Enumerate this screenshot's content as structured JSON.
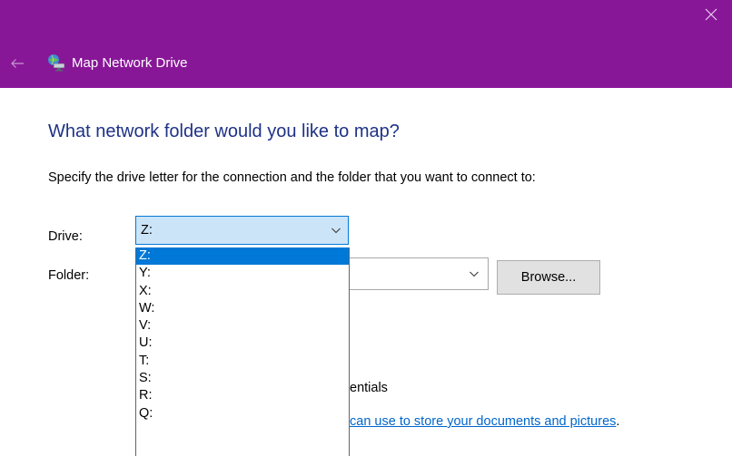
{
  "window": {
    "title": "Map Network Drive",
    "close_glyph": "×",
    "back_glyph": "←",
    "colors": {
      "titlebar": "#881798",
      "accent": "#0078d7",
      "heading": "#1e3287",
      "link": "#0066cc"
    },
    "icons": {
      "back": "back-arrow-icon",
      "app": "network-drive-icon",
      "close": "close-icon",
      "dropdown": "chevron-down-icon"
    }
  },
  "content": {
    "heading": "What network folder would you like to map?",
    "instructions": "Specify the drive letter for the connection and the folder that you want to connect to:"
  },
  "drive": {
    "label": "Drive:",
    "value": "Z:",
    "options": [
      "Z:",
      "Y:",
      "X:",
      "W:",
      "V:",
      "U:",
      "T:",
      "S:",
      "R:",
      "Q:"
    ],
    "selected_index": 0
  },
  "folder": {
    "label": "Folder:",
    "value": ""
  },
  "browse_label": "Browse...",
  "credentials_fragment": "entials",
  "link_fragment": "can use to store your documents and pictures",
  "link_trailing": "."
}
